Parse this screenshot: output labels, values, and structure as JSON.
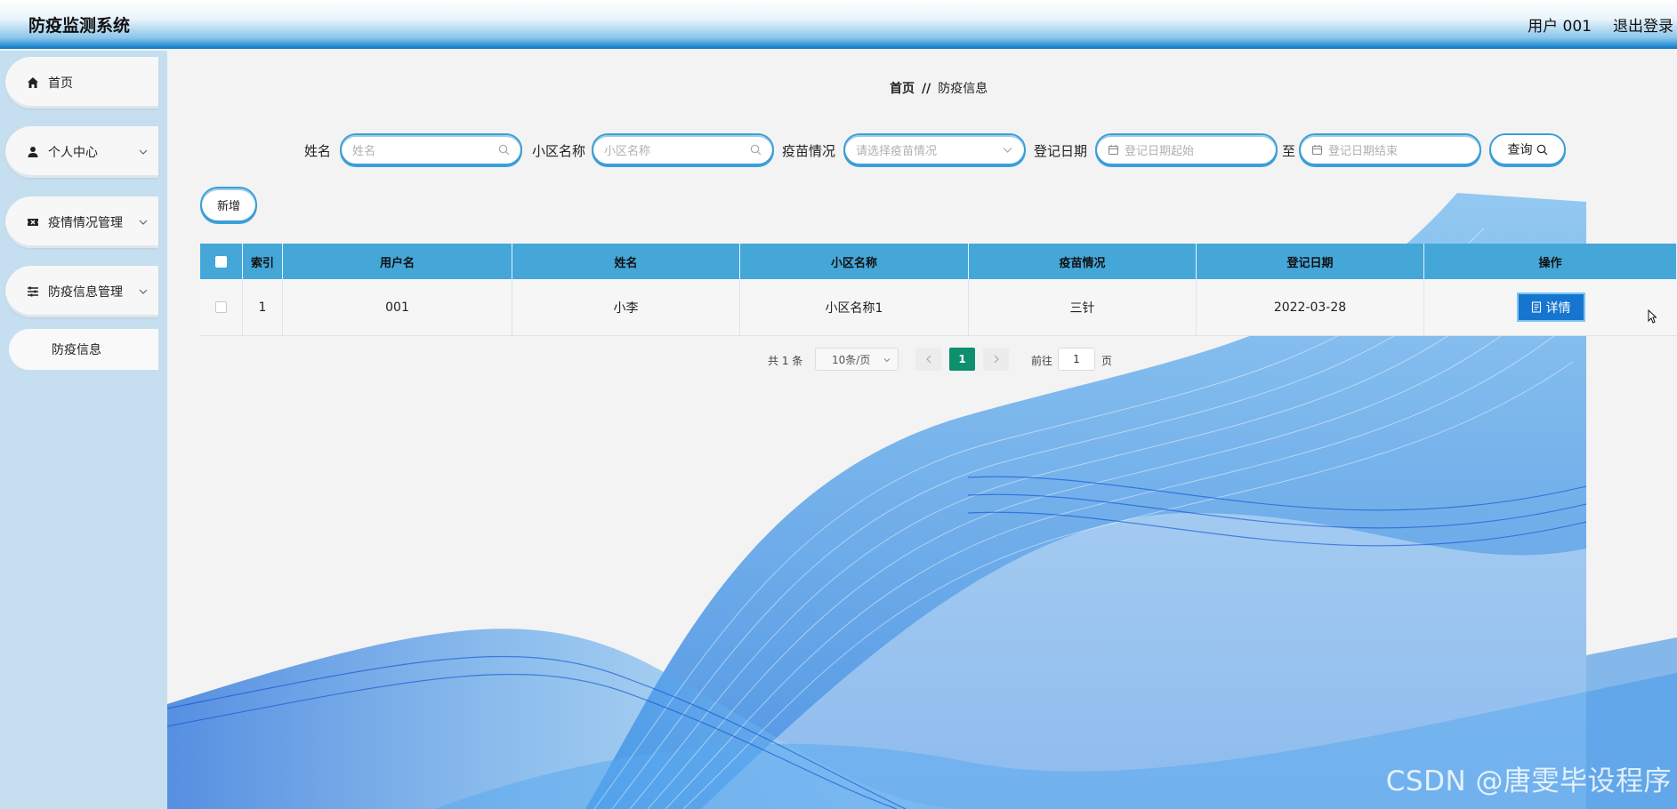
{
  "header": {
    "title": "防疫监测系统",
    "user": "用户 001",
    "logout": "退出登录"
  },
  "sidebar": {
    "items": [
      {
        "label": "首页",
        "icon": "home-icon"
      },
      {
        "label": "个人中心",
        "icon": "user-icon"
      },
      {
        "label": "疫情情况管理",
        "icon": "ticket-icon"
      },
      {
        "label": "防疫信息管理",
        "icon": "sliders-icon"
      }
    ],
    "sub": {
      "label": "防疫信息"
    }
  },
  "breadcrumb": {
    "home": "首页",
    "separator": "//",
    "current": "防疫信息"
  },
  "search": {
    "name_label": "姓名",
    "name_placeholder": "姓名",
    "community_label": "小区名称",
    "community_placeholder": "小区名称",
    "vaccine_label": "疫苗情况",
    "vaccine_placeholder": "请选择疫苗情况",
    "date_label": "登记日期",
    "date_start_placeholder": "登记日期起始",
    "date_to": "至",
    "date_end_placeholder": "登记日期结束",
    "query_label": "查询"
  },
  "toolbar": {
    "add_label": "新增"
  },
  "table": {
    "headers": [
      "索引",
      "用户名",
      "姓名",
      "小区名称",
      "疫苗情况",
      "登记日期",
      "操作"
    ],
    "rows": [
      {
        "index": "1",
        "username": "001",
        "name": "小李",
        "community": "小区名称1",
        "vaccine": "三针",
        "date": "2022-03-28",
        "action": "详情"
      }
    ]
  },
  "pagination": {
    "total": "共 1 条",
    "page_size": "10条/页",
    "current": "1",
    "goto_label": "前往",
    "goto_value": "1",
    "goto_unit": "页"
  },
  "watermark": "CSDN @唐雯毕设程序",
  "colors": {
    "header_accent": "#1a86cf",
    "table_header": "#45a6d8",
    "detail_button": "#1676cf",
    "pager_current": "#0e8f6d",
    "sidebar": "#c5dff0"
  }
}
